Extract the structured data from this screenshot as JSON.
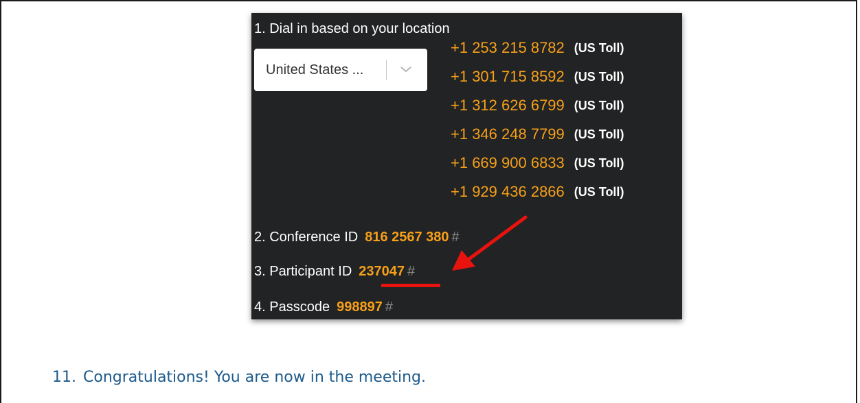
{
  "dial_in": {
    "step1_label": "1. Dial in based on your location",
    "country_select": {
      "value": "United States ..."
    },
    "numbers": [
      {
        "number": "+1 253 215 8782",
        "type": "(US Toll)"
      },
      {
        "number": "+1 301 715 8592",
        "type": "(US Toll)"
      },
      {
        "number": "+1 312 626 6799",
        "type": "(US Toll)"
      },
      {
        "number": "+1 346 248 7799",
        "type": "(US Toll)"
      },
      {
        "number": "+1 669 900 6833",
        "type": "(US Toll)"
      },
      {
        "number": "+1 929 436 2866",
        "type": "(US Toll)"
      }
    ],
    "conference_id": {
      "label": "2. Conference ID",
      "value": "816 2567 380",
      "hash": "#"
    },
    "participant_id": {
      "label": "3. Participant ID",
      "value": "237047",
      "hash": "#"
    },
    "passcode": {
      "label": "4. Passcode",
      "value": "998897",
      "hash": "#"
    }
  },
  "instructions": {
    "step_number": "11.",
    "step_text": "Congratulations! You are now in the meeting."
  },
  "colors": {
    "panel_bg": "#222324",
    "accent_orange": "#f6a01a",
    "annotation_red": "#e8130e",
    "link_blue": "#1d5a8c"
  }
}
